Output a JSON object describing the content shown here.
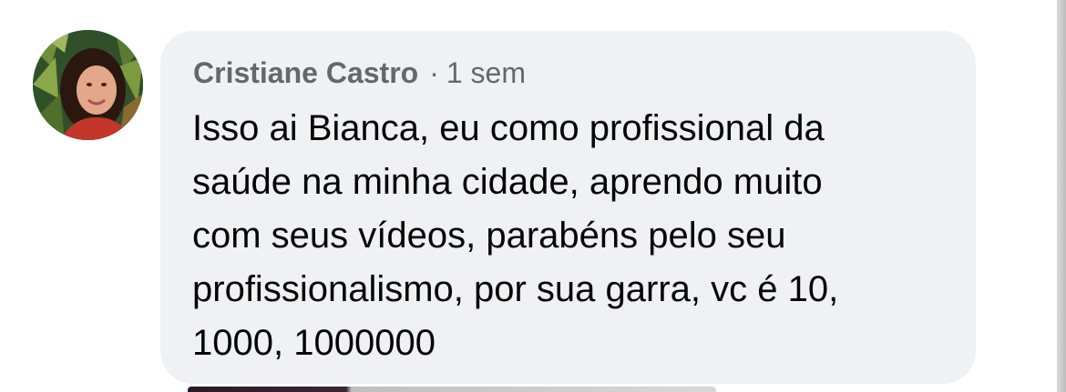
{
  "comment": {
    "author": "Cristiane Castro",
    "separator": "·",
    "time": "1 sem",
    "text": "Isso ai Bianca, eu como profissional da\nsaúde na minha cidade, aprendo muito\ncom seus vídeos,  parabéns pelo seu\nprofissionalismo,  por sua garra, vc é 10,\n1000, 1000000"
  },
  "colors": {
    "bubble_background": "#f0f1f5",
    "author_text": "#65676b",
    "comment_text": "#050505"
  },
  "icons": {
    "avatar": "profile-photo"
  }
}
